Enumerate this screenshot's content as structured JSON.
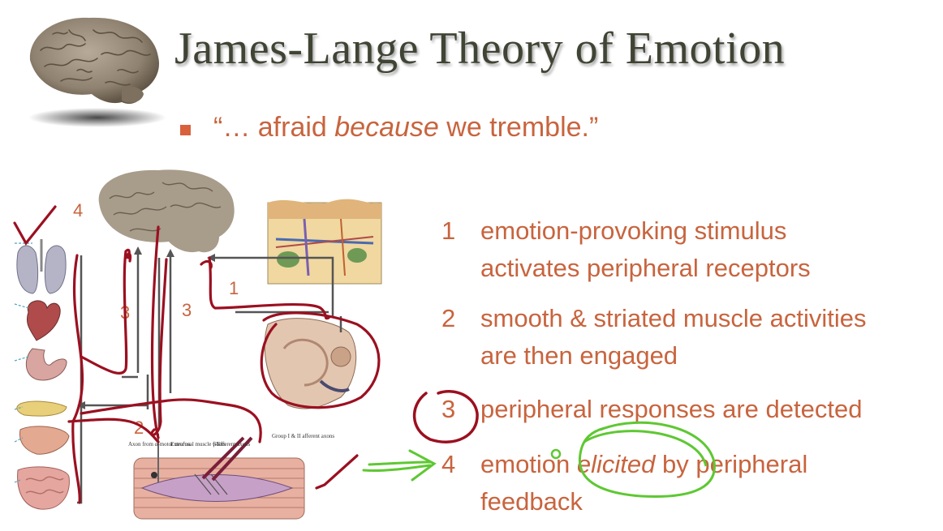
{
  "slide": {
    "title": "James-Lange Theory of Emotion",
    "bullet": {
      "open": "“… afraid ",
      "emph": "because",
      "close": " we tremble.”"
    },
    "items": [
      {
        "num": "1",
        "line1": "emotion-provoking stimulus",
        "line2": "activates peripheral receptors"
      },
      {
        "num": "2",
        "line1": "smooth & striated muscle activities",
        "line2": "are then engaged"
      },
      {
        "num": "3",
        "line1": "peripheral responses are detected",
        "line2": ""
      },
      {
        "num": "4",
        "pre": "emotion ",
        "emph": "elicited",
        "post": " by peripheral",
        "line2": "feedback"
      }
    ]
  },
  "diagram": {
    "labels": [
      "4",
      "3",
      "3",
      "1",
      "2"
    ],
    "muscle_labels": [
      "Axon from α-motor neuron",
      "Extrafusal muscle fibers",
      "γ-Efferent axons",
      "Group I & II afferent axons"
    ]
  },
  "colors": {
    "title": "#3f4434",
    "accent": "#c8643e",
    "bullet": "#d8613c",
    "annotation_red": "#9b1020",
    "annotation_green": "#5ec832"
  },
  "icons": [
    "brain-icon",
    "lungs-icon",
    "heart-icon",
    "stomach-icon",
    "pancreas-icon",
    "liver-icon",
    "intestine-icon",
    "skin-icon",
    "ear-icon",
    "muscle-icon"
  ]
}
